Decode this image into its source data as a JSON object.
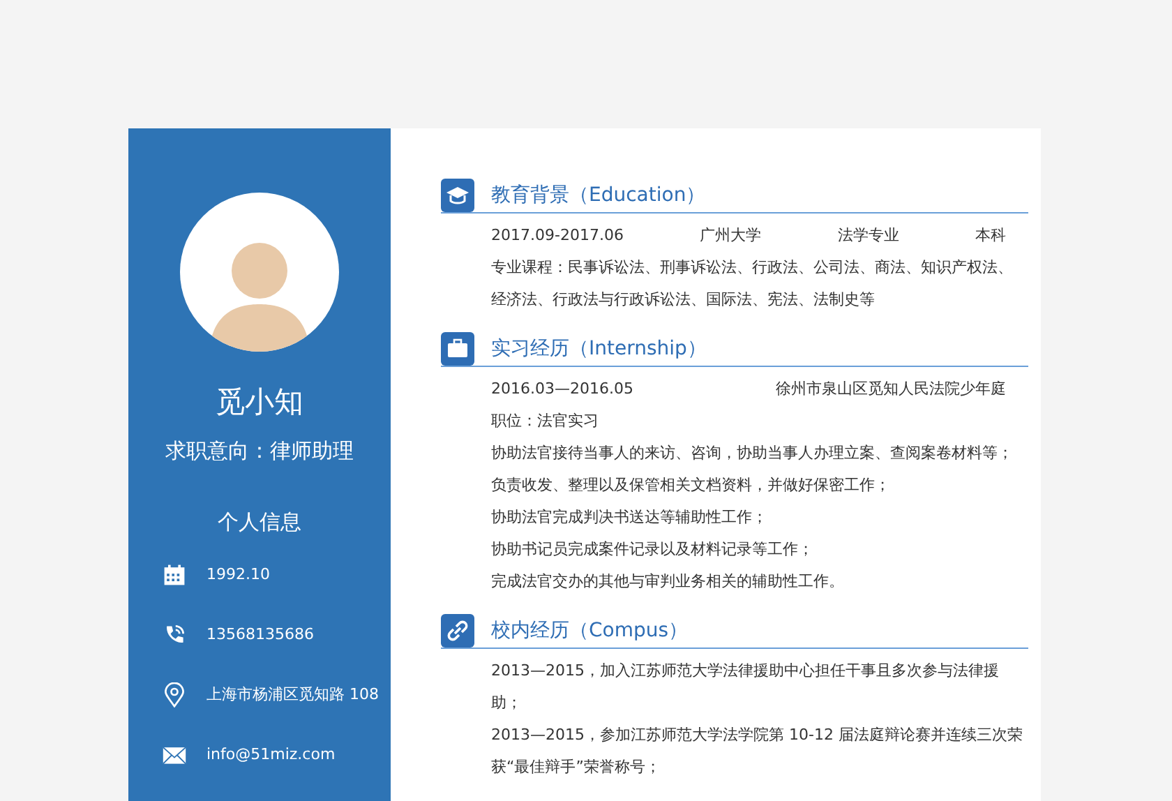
{
  "profile": {
    "name": "觅小知",
    "objective": "求职意向：律师助理"
  },
  "info": {
    "title": "个人信息",
    "items": [
      {
        "kind": "date",
        "text": "1992.10"
      },
      {
        "kind": "phone",
        "text": "13568135686"
      },
      {
        "kind": "location",
        "text": "上海市杨浦区觅知路 108"
      },
      {
        "kind": "email",
        "text": "info@51miz.com"
      }
    ]
  },
  "sections": [
    {
      "kind": "education",
      "title": "教育背景（Education）",
      "header_row": [
        "2017.09-2017.06",
        "广州大学",
        "法学专业",
        "本科"
      ],
      "lines": [
        "专业课程：民事诉讼法、刑事诉讼法、行政法、公司法、商法、知识产权法、经济法、行政法与行政诉讼法、国际法、宪法、法制史等"
      ]
    },
    {
      "kind": "internship",
      "title": "实习经历（Internship）",
      "header_row": [
        "2016.03—2016.05",
        "徐州市泉山区觅知人民法院少年庭"
      ],
      "lines": [
        "职位：法官实习",
        "协助法官接待当事人的来访、咨询，协助当事人办理立案、查阅案卷材料等；",
        "负责收发、整理以及保管相关文档资料，并做好保密工作；",
        "协助法官完成判决书送达等辅助性工作；",
        "协助书记员完成案件记录以及材料记录等工作；",
        "完成法官交办的其他与审判业务相关的辅助性工作。"
      ]
    },
    {
      "kind": "campus",
      "title": "校内经历（Compus）",
      "lines": [
        "2013—2015，加入江苏师范大学法律援助中心担任干事且多次参与法律援助；",
        "2013—2015，参加江苏师范大学法学院第 10-12 届法庭辩论赛并连续三次荣获“最佳辩手”荣誉称号；"
      ]
    }
  ]
}
